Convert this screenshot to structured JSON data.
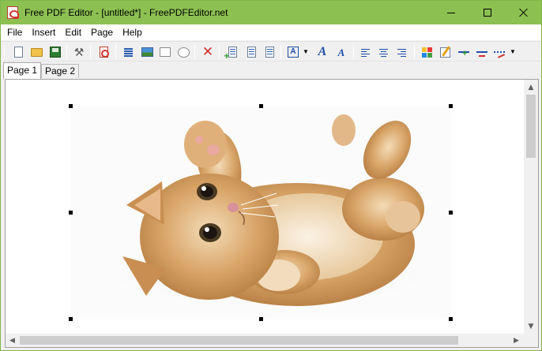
{
  "window": {
    "title": "Free PDF Editor - [untitled*] - FreePDFEditor.net",
    "icons": {
      "app": "pdf-app-icon",
      "minimize": "minimize-icon",
      "maximize": "maximize-icon",
      "close": "close-icon"
    }
  },
  "menu": {
    "items": [
      "File",
      "Insert",
      "Edit",
      "Page",
      "Help"
    ]
  },
  "toolbar": {
    "buttons": [
      "new-document",
      "open-document",
      "save-document",
      "settings-tools",
      "export-pdf",
      "insert-text",
      "insert-image",
      "insert-rectangle",
      "insert-ellipse",
      "delete",
      "add-page",
      "page-properties",
      "page-content",
      "font-picker",
      "font-style",
      "font-color",
      "align-left",
      "align-center",
      "align-right",
      "color-grid",
      "edit-object",
      "add-line",
      "remove-line",
      "line-style"
    ]
  },
  "tabs": {
    "items": [
      "Page 1",
      "Page 2"
    ],
    "active": "Page 1"
  },
  "canvas": {
    "image": "kitten-photo",
    "selected": true
  },
  "colors": {
    "title_bar": "#8cc152",
    "accent": "#1f4ea8",
    "delete": "#d32f2f"
  }
}
